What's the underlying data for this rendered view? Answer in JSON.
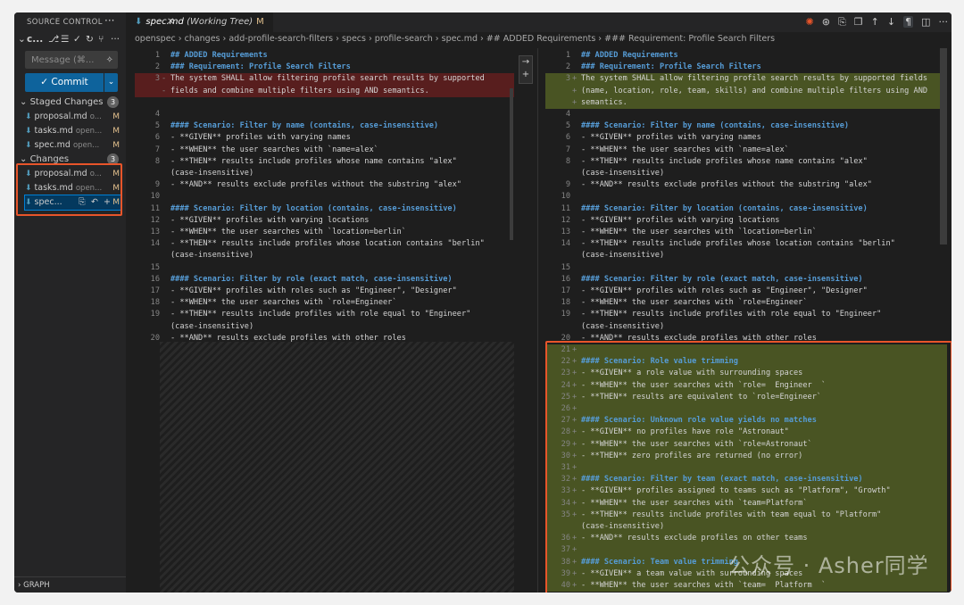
{
  "sidebar": {
    "title": "SOURCE CONTROL",
    "more_label": "···",
    "repo_label": "c...",
    "message_placeholder": "Message (⌘...",
    "commit_label": "✓ Commit",
    "staged": {
      "label": "Staged Changes",
      "count": "3",
      "files": [
        {
          "name": "proposal.md",
          "dir": "o...",
          "status": "M"
        },
        {
          "name": "tasks.md",
          "dir": "open...",
          "status": "M"
        },
        {
          "name": "spec.md",
          "dir": "open...",
          "status": "M"
        }
      ]
    },
    "changes": {
      "label": "Changes",
      "count": "3",
      "files": [
        {
          "name": "proposal.md",
          "dir": "o...",
          "status": "M"
        },
        {
          "name": "tasks.md",
          "dir": "open...",
          "status": "M"
        },
        {
          "name": "spec...",
          "dir": "",
          "status": "M"
        }
      ]
    },
    "graph_label": "GRAPH"
  },
  "tab": {
    "file": "spec.md",
    "suffix": "(Working Tree)",
    "status": "M",
    "close": "✕"
  },
  "breadcrumb": "openspec › changes › add-profile-search-filters › specs › profile-search › spec.md › ## ADDED Requirements › ### Requirement: Profile Search Filters",
  "left_lines": [
    {
      "n": "1",
      "m": "",
      "t": "## ADDED Requirements",
      "c": "hdr",
      "bg": ""
    },
    {
      "n": "2",
      "m": "",
      "t": "### Requirement: Profile Search Filters",
      "c": "hdr",
      "bg": ""
    },
    {
      "n": "3",
      "m": "-",
      "t": "The system SHALL allow filtering profile search results by supported",
      "c": "",
      "bg": "del"
    },
    {
      "n": "",
      "m": "-",
      "t": "fields and combine multiple filters using AND semantics.",
      "c": "",
      "bg": "del"
    },
    {
      "n": "",
      "m": "",
      "t": "",
      "c": "",
      "bg": ""
    },
    {
      "n": "4",
      "m": "",
      "t": "",
      "c": "",
      "bg": ""
    },
    {
      "n": "5",
      "m": "",
      "t": "#### Scenario: Filter by name (contains, case-insensitive)",
      "c": "hdr",
      "bg": ""
    },
    {
      "n": "6",
      "m": "",
      "t": "- **GIVEN** profiles with varying names",
      "c": "",
      "bg": ""
    },
    {
      "n": "7",
      "m": "",
      "t": "- **WHEN** the user searches with `name=alex`",
      "c": "",
      "bg": ""
    },
    {
      "n": "8",
      "m": "",
      "t": "- **THEN** results include profiles whose name contains \"alex\"",
      "c": "",
      "bg": ""
    },
    {
      "n": "",
      "m": "",
      "t": "(case-insensitive)",
      "c": "",
      "bg": ""
    },
    {
      "n": "9",
      "m": "",
      "t": "- **AND** results exclude profiles without the substring \"alex\"",
      "c": "",
      "bg": ""
    },
    {
      "n": "10",
      "m": "",
      "t": "",
      "c": "",
      "bg": ""
    },
    {
      "n": "11",
      "m": "",
      "t": "#### Scenario: Filter by location (contains, case-insensitive)",
      "c": "hdr",
      "bg": ""
    },
    {
      "n": "12",
      "m": "",
      "t": "- **GIVEN** profiles with varying locations",
      "c": "",
      "bg": ""
    },
    {
      "n": "13",
      "m": "",
      "t": "- **WHEN** the user searches with `location=berlin`",
      "c": "",
      "bg": ""
    },
    {
      "n": "14",
      "m": "",
      "t": "- **THEN** results include profiles whose location contains \"berlin\"",
      "c": "",
      "bg": ""
    },
    {
      "n": "",
      "m": "",
      "t": "(case-insensitive)",
      "c": "",
      "bg": ""
    },
    {
      "n": "15",
      "m": "",
      "t": "",
      "c": "",
      "bg": ""
    },
    {
      "n": "16",
      "m": "",
      "t": "#### Scenario: Filter by role (exact match, case-insensitive)",
      "c": "hdr",
      "bg": ""
    },
    {
      "n": "17",
      "m": "",
      "t": "- **GIVEN** profiles with roles such as \"Engineer\", \"Designer\"",
      "c": "",
      "bg": ""
    },
    {
      "n": "18",
      "m": "",
      "t": "- **WHEN** the user searches with `role=Engineer`",
      "c": "",
      "bg": ""
    },
    {
      "n": "19",
      "m": "",
      "t": "- **THEN** results include profiles with role equal to \"Engineer\"",
      "c": "",
      "bg": ""
    },
    {
      "n": "",
      "m": "",
      "t": "(case-insensitive)",
      "c": "",
      "bg": ""
    },
    {
      "n": "20",
      "m": "",
      "t": "- **AND** results exclude profiles with other roles",
      "c": "",
      "bg": ""
    }
  ],
  "right_lines": [
    {
      "n": "1",
      "m": "",
      "t": "## ADDED Requirements",
      "c": "hdr",
      "bg": ""
    },
    {
      "n": "2",
      "m": "",
      "t": "### Requirement: Profile Search Filters",
      "c": "hdr",
      "bg": ""
    },
    {
      "n": "3",
      "m": "+",
      "t": "The system SHALL allow filtering profile search results by supported fields",
      "c": "",
      "bg": "add"
    },
    {
      "n": "",
      "m": "+",
      "t": "(name, location, role, team, skills) and combine multiple filters using AND",
      "c": "",
      "bg": "add"
    },
    {
      "n": "",
      "m": "+",
      "t": "semantics.",
      "c": "",
      "bg": "add"
    },
    {
      "n": "4",
      "m": "",
      "t": "",
      "c": "",
      "bg": ""
    },
    {
      "n": "5",
      "m": "",
      "t": "#### Scenario: Filter by name (contains, case-insensitive)",
      "c": "hdr",
      "bg": ""
    },
    {
      "n": "6",
      "m": "",
      "t": "- **GIVEN** profiles with varying names",
      "c": "",
      "bg": ""
    },
    {
      "n": "7",
      "m": "",
      "t": "- **WHEN** the user searches with `name=alex`",
      "c": "",
      "bg": ""
    },
    {
      "n": "8",
      "m": "",
      "t": "- **THEN** results include profiles whose name contains \"alex\"",
      "c": "",
      "bg": ""
    },
    {
      "n": "",
      "m": "",
      "t": "(case-insensitive)",
      "c": "",
      "bg": ""
    },
    {
      "n": "9",
      "m": "",
      "t": "- **AND** results exclude profiles without the substring \"alex\"",
      "c": "",
      "bg": ""
    },
    {
      "n": "10",
      "m": "",
      "t": "",
      "c": "",
      "bg": ""
    },
    {
      "n": "11",
      "m": "",
      "t": "#### Scenario: Filter by location (contains, case-insensitive)",
      "c": "hdr",
      "bg": ""
    },
    {
      "n": "12",
      "m": "",
      "t": "- **GIVEN** profiles with varying locations",
      "c": "",
      "bg": ""
    },
    {
      "n": "13",
      "m": "",
      "t": "- **WHEN** the user searches with `location=berlin`",
      "c": "",
      "bg": ""
    },
    {
      "n": "14",
      "m": "",
      "t": "- **THEN** results include profiles whose location contains \"berlin\"",
      "c": "",
      "bg": ""
    },
    {
      "n": "",
      "m": "",
      "t": "(case-insensitive)",
      "c": "",
      "bg": ""
    },
    {
      "n": "15",
      "m": "",
      "t": "",
      "c": "",
      "bg": ""
    },
    {
      "n": "16",
      "m": "",
      "t": "#### Scenario: Filter by role (exact match, case-insensitive)",
      "c": "hdr",
      "bg": ""
    },
    {
      "n": "17",
      "m": "",
      "t": "- **GIVEN** profiles with roles such as \"Engineer\", \"Designer\"",
      "c": "",
      "bg": ""
    },
    {
      "n": "18",
      "m": "",
      "t": "- **WHEN** the user searches with `role=Engineer`",
      "c": "",
      "bg": ""
    },
    {
      "n": "19",
      "m": "",
      "t": "- **THEN** results include profiles with role equal to \"Engineer\"",
      "c": "",
      "bg": ""
    },
    {
      "n": "",
      "m": "",
      "t": "(case-insensitive)",
      "c": "",
      "bg": ""
    },
    {
      "n": "20",
      "m": "",
      "t": "- **AND** results exclude profiles with other roles",
      "c": "",
      "bg": ""
    },
    {
      "n": "21",
      "m": "+",
      "t": "",
      "c": "",
      "bg": "add"
    },
    {
      "n": "22",
      "m": "+",
      "t": "#### Scenario: Role value trimming",
      "c": "hdr",
      "bg": "add"
    },
    {
      "n": "23",
      "m": "+",
      "t": "- **GIVEN** a role value with surrounding spaces",
      "c": "",
      "bg": "add"
    },
    {
      "n": "24",
      "m": "+",
      "t": "- **WHEN** the user searches with `role=  Engineer  `",
      "c": "",
      "bg": "add"
    },
    {
      "n": "25",
      "m": "+",
      "t": "- **THEN** results are equivalent to `role=Engineer`",
      "c": "",
      "bg": "add"
    },
    {
      "n": "26",
      "m": "+",
      "t": "",
      "c": "",
      "bg": "add"
    },
    {
      "n": "27",
      "m": "+",
      "t": "#### Scenario: Unknown role value yields no matches",
      "c": "hdr",
      "bg": "add"
    },
    {
      "n": "28",
      "m": "+",
      "t": "- **GIVEN** no profiles have role \"Astronaut\"",
      "c": "",
      "bg": "add"
    },
    {
      "n": "29",
      "m": "+",
      "t": "- **WHEN** the user searches with `role=Astronaut`",
      "c": "",
      "bg": "add"
    },
    {
      "n": "30",
      "m": "+",
      "t": "- **THEN** zero profiles are returned (no error)",
      "c": "",
      "bg": "add"
    },
    {
      "n": "31",
      "m": "+",
      "t": "",
      "c": "",
      "bg": "add"
    },
    {
      "n": "32",
      "m": "+",
      "t": "#### Scenario: Filter by team (exact match, case-insensitive)",
      "c": "hdr",
      "bg": "add"
    },
    {
      "n": "33",
      "m": "+",
      "t": "- **GIVEN** profiles assigned to teams such as \"Platform\", \"Growth\"",
      "c": "",
      "bg": "add"
    },
    {
      "n": "34",
      "m": "+",
      "t": "- **WHEN** the user searches with `team=Platform`",
      "c": "",
      "bg": "add"
    },
    {
      "n": "35",
      "m": "+",
      "t": "- **THEN** results include profiles with team equal to \"Platform\"",
      "c": "",
      "bg": "add"
    },
    {
      "n": "",
      "m": "",
      "t": "(case-insensitive)",
      "c": "",
      "bg": "add"
    },
    {
      "n": "36",
      "m": "+",
      "t": "- **AND** results exclude profiles on other teams",
      "c": "",
      "bg": "add"
    },
    {
      "n": "37",
      "m": "+",
      "t": "",
      "c": "",
      "bg": "add"
    },
    {
      "n": "38",
      "m": "+",
      "t": "#### Scenario: Team value trimming",
      "c": "hdr",
      "bg": "add"
    },
    {
      "n": "39",
      "m": "+",
      "t": "- **GIVEN** a team value with surrounding spaces",
      "c": "",
      "bg": "add"
    },
    {
      "n": "40",
      "m": "+",
      "t": "- **WHEN** the user searches with `team=  Platform  `",
      "c": "",
      "bg": "add"
    }
  ],
  "watermark": "公众号 · Asher同学",
  "colors": {
    "accent": "#0e639c",
    "highlight": "#e8552a",
    "added": "#6e8228",
    "deleted": "#a01e1e"
  }
}
